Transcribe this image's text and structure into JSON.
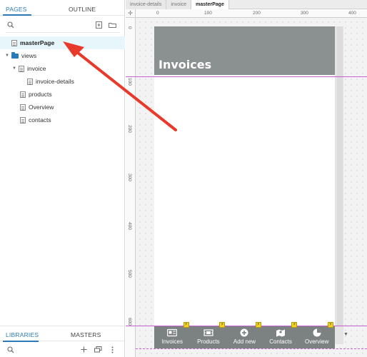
{
  "left_panel": {
    "tabs": {
      "pages": "PAGES",
      "outline": "OUTLINE"
    },
    "tree": [
      {
        "label": "masterPage",
        "icon": "page-icon",
        "selected": true
      },
      {
        "label": "views",
        "icon": "folder-icon"
      },
      {
        "label": "invoice",
        "icon": "page-icon"
      },
      {
        "label": "invoice-details",
        "icon": "page-icon"
      },
      {
        "label": "products",
        "icon": "page-icon"
      },
      {
        "label": "Overview",
        "icon": "page-icon"
      },
      {
        "label": "contacts",
        "icon": "page-icon"
      }
    ],
    "bottom_tabs": {
      "libraries": "LIBRARIES",
      "masters": "MASTERS"
    }
  },
  "doc_tabs": [
    "invoice-details",
    "invoice",
    "masterPage"
  ],
  "ruler": {
    "top": [
      "0",
      "100",
      "200",
      "300",
      "400"
    ],
    "left": [
      "0",
      "100",
      "200",
      "300",
      "400",
      "500",
      "600"
    ]
  },
  "artboard": {
    "header_title": "Invoices",
    "header_color": "#8b9090",
    "nav": [
      {
        "label": "Invoices",
        "icon": "invoice-icon"
      },
      {
        "label": "Products",
        "icon": "ticket-icon"
      },
      {
        "label": "Add new",
        "icon": "plus-circle-icon"
      },
      {
        "label": "Contacts",
        "icon": "map-icon"
      },
      {
        "label": "Overview",
        "icon": "pie-chart-icon"
      }
    ],
    "badge_text": "⚡"
  },
  "annotation": {
    "arrow_color": "#e8392a"
  },
  "colors": {
    "accent": "#2a7ab8",
    "guide": "#c65fd0",
    "selected_row": "#e6f6fb"
  }
}
